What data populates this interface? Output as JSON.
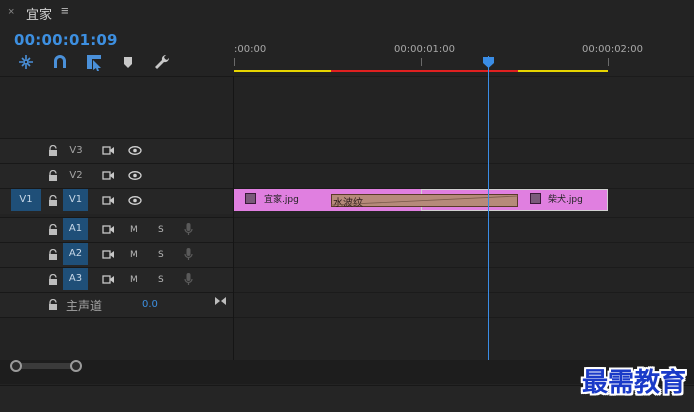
{
  "panel": {
    "close_glyph": "×",
    "sequence_name": "宜家",
    "menu_glyph": "≡",
    "timecode": "00:00:01:09"
  },
  "toolbar": {
    "icons": [
      "nest-sequence-icon",
      "snap-magnet-icon",
      "linked-selection-icon",
      "add-marker-icon",
      "timeline-settings-wrench-icon"
    ]
  },
  "ruler": {
    "labels": [
      ":00:00",
      "00:00:01:00",
      "00:00:02:00"
    ]
  },
  "tracks": {
    "video": [
      {
        "name": "V3",
        "source": ""
      },
      {
        "name": "V2",
        "source": ""
      },
      {
        "name": "V1",
        "source": "V1"
      }
    ],
    "audio": [
      {
        "name": "A1",
        "mute": "M",
        "solo": "S"
      },
      {
        "name": "A2",
        "mute": "M",
        "solo": "S"
      },
      {
        "name": "A3",
        "mute": "M",
        "solo": "S"
      }
    ],
    "master": {
      "label": "主声道",
      "value": "0.0"
    }
  },
  "clips": [
    {
      "name": "宜家.jpg",
      "color": "#e07fe0"
    },
    {
      "name": "柴犬.jpg",
      "color": "#e07fe0"
    }
  ],
  "transition": {
    "name": "水波纹"
  },
  "colors": {
    "accent": "#3a8de6",
    "track_target": "#1f4f78",
    "render_bar_yellow": "#e6d400",
    "render_bar_red": "#e02020"
  },
  "watermark": "最需教育"
}
